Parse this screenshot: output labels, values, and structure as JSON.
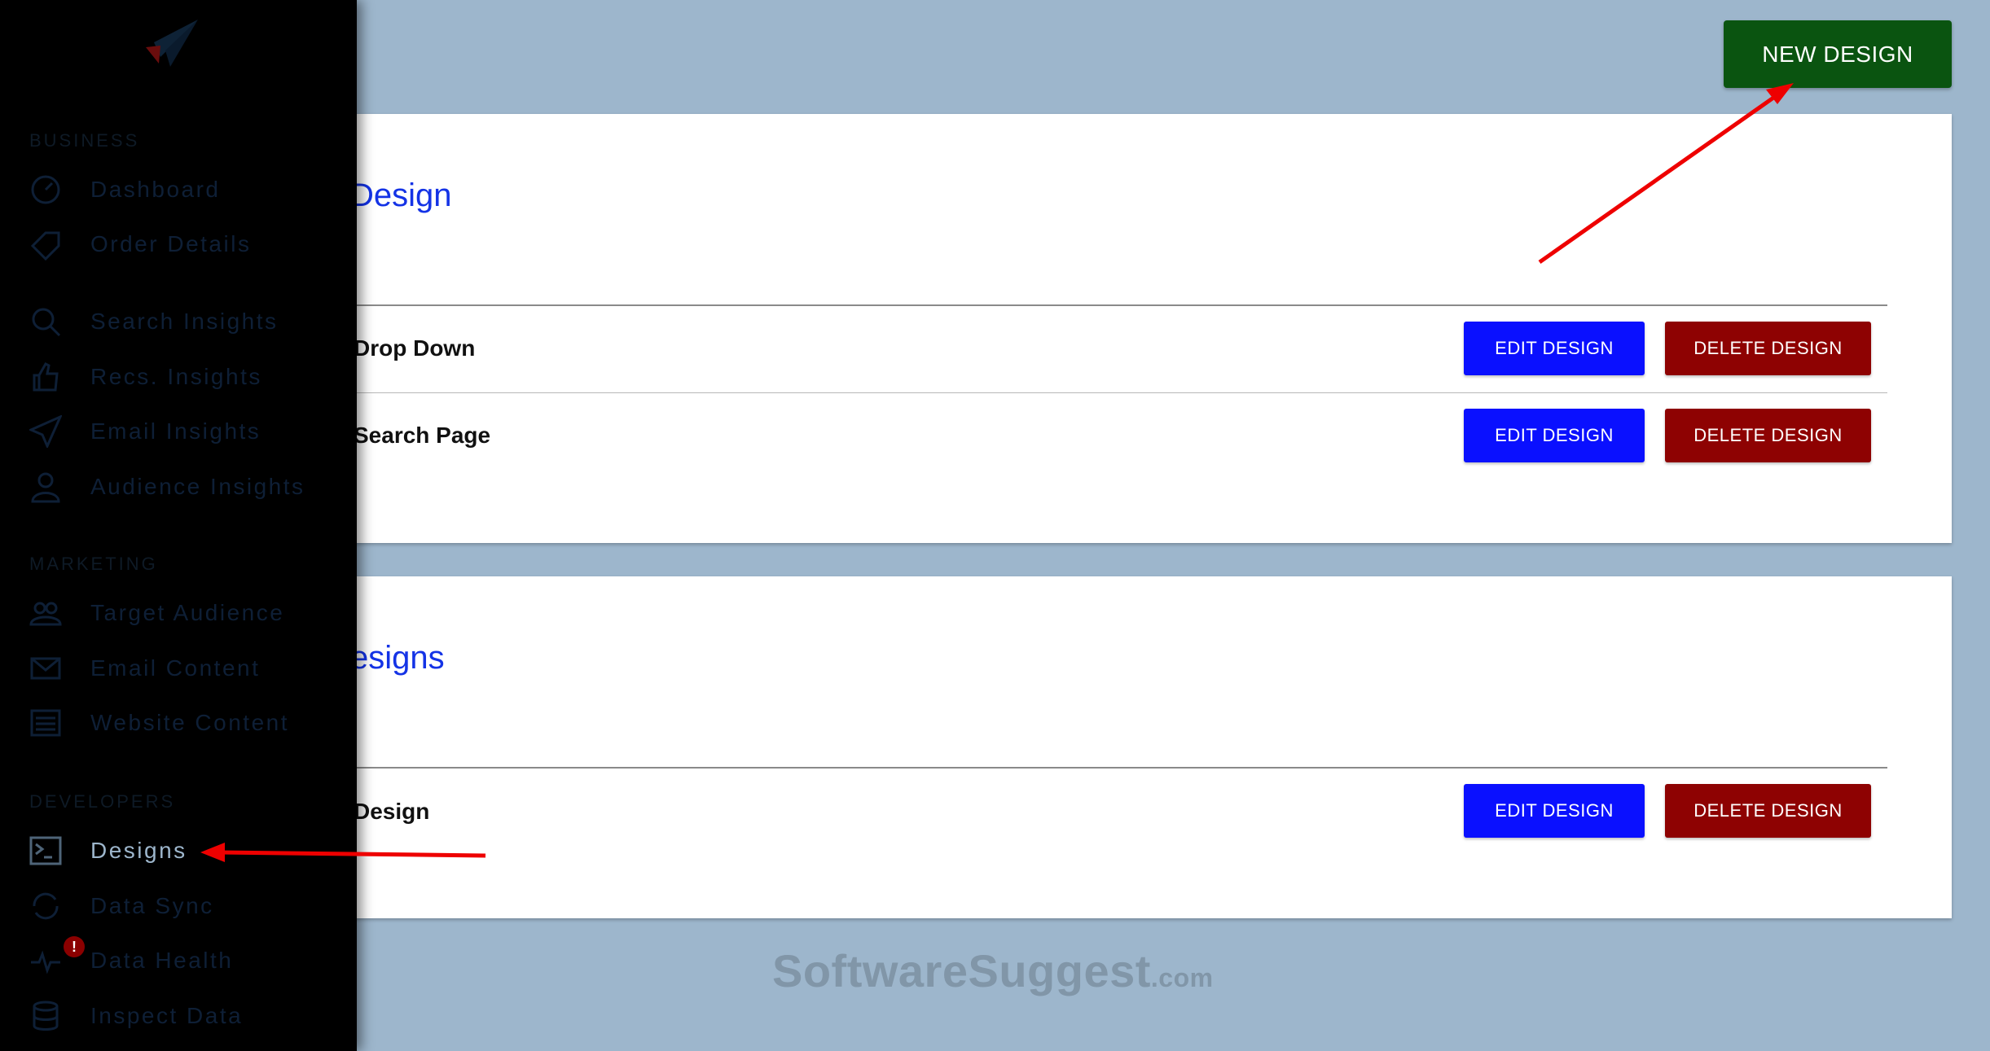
{
  "sidebar": {
    "sections": {
      "business": "BUSINESS",
      "marketing": "MARKETING",
      "developers": "DEVELOPERS"
    },
    "items": [
      {
        "label": "Dashboard",
        "icon": "dashboard-icon"
      },
      {
        "label": "Order Details",
        "icon": "tag-icon"
      },
      {
        "label": "Search Insights",
        "icon": "search-icon"
      },
      {
        "label": "Recs. Insights",
        "icon": "thumbs-up-icon"
      },
      {
        "label": "Email Insights",
        "icon": "paper-plane-icon"
      },
      {
        "label": "Audience Insights",
        "icon": "user-icon"
      },
      {
        "label": "Target Audience",
        "icon": "users-icon"
      },
      {
        "label": "Email Content",
        "icon": "envelope-icon"
      },
      {
        "label": "Website Content",
        "icon": "list-icon"
      },
      {
        "label": "Designs",
        "icon": "terminal-icon",
        "active": true
      },
      {
        "label": "Data Sync",
        "icon": "sync-icon"
      },
      {
        "label": "Data Health",
        "icon": "heartbeat-icon"
      },
      {
        "label": "Inspect Data",
        "icon": "database-icon"
      }
    ],
    "badge": "!"
  },
  "header": {
    "new_design_label": "NEW DESIGN"
  },
  "cards": [
    {
      "title": "Design",
      "rows": [
        {
          "name": "Drop Down",
          "edit_label": "EDIT DESIGN",
          "delete_label": "DELETE DESIGN"
        },
        {
          "name": "Search Page",
          "edit_label": "EDIT DESIGN",
          "delete_label": "DELETE DESIGN"
        }
      ]
    },
    {
      "title": "esigns",
      "rows": [
        {
          "name": "Design",
          "edit_label": "EDIT DESIGN",
          "delete_label": "DELETE DESIGN"
        }
      ]
    }
  ],
  "watermark": {
    "text": "SoftwareSuggest",
    "tld": ".com"
  },
  "colors": {
    "background": "#9db6cc",
    "sidebar": "#000000",
    "new_design": "#0a5410",
    "edit": "#0a10ff",
    "delete": "#8e0202",
    "title": "#1433e6",
    "annotation_arrow": "#ee0000"
  }
}
